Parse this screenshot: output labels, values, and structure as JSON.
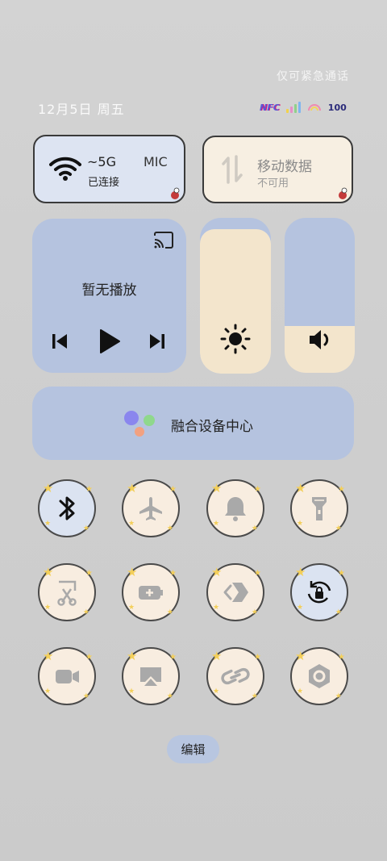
{
  "status": {
    "emergency_text": "仅可紧急通话",
    "date_text": "12月5日 周五",
    "nfc_label": "NFC",
    "battery": "100"
  },
  "wifi": {
    "name": "~5G",
    "name_tail": "MIC",
    "status": "已连接"
  },
  "mobile": {
    "title": "移动数据",
    "status": "不可用"
  },
  "media": {
    "title": "暂无播放"
  },
  "sliders": {
    "brightness_level": 0.93,
    "volume_level": 0.3
  },
  "fusion": {
    "label": "融合设备中心"
  },
  "tiles": [
    {
      "icon": "bluetooth-icon",
      "active": true
    },
    {
      "icon": "airplane-icon",
      "active": false
    },
    {
      "icon": "bell-icon",
      "active": false
    },
    {
      "icon": "flashlight-icon",
      "active": false
    },
    {
      "icon": "screenshot-icon",
      "active": false
    },
    {
      "icon": "battery-saver-icon",
      "active": false
    },
    {
      "icon": "nearby-share-icon",
      "active": false
    },
    {
      "icon": "rotation-lock-icon",
      "active": true
    },
    {
      "icon": "screen-record-icon",
      "active": false
    },
    {
      "icon": "screen-cast-icon",
      "active": false
    },
    {
      "icon": "link-icon",
      "active": false
    },
    {
      "icon": "nut-settings-icon",
      "active": false
    }
  ],
  "edit": {
    "label": "编辑"
  },
  "colors": {
    "card_blue": "#b5c3df",
    "card_cream": "#f3e5cc",
    "active_tile": "#dbe3f1"
  }
}
